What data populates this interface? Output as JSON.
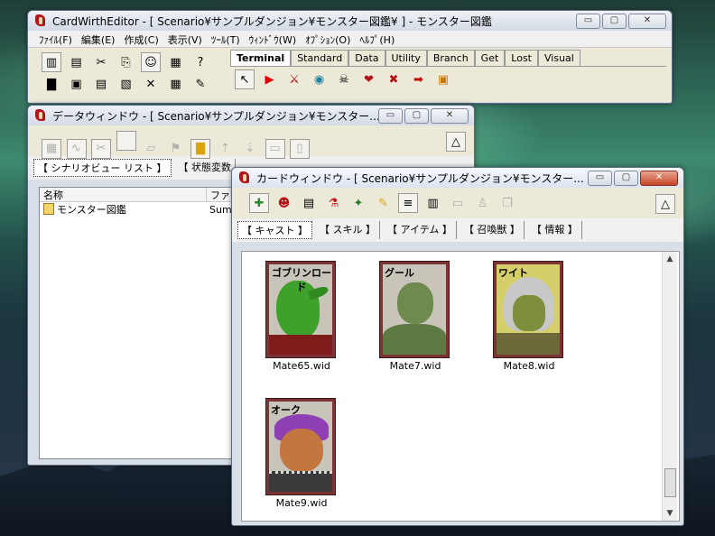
{
  "main_window": {
    "title": "CardWirthEditor - [ Scenario¥サンプルダンジョン¥モンスター図鑑¥ ] - モンスター図鑑",
    "menu": [
      "ﾌｧｲﾙ(F)",
      "編集(E)",
      "作成(C)",
      "表示(V)",
      "ﾂｰﾙ(T)",
      "ｳｨﾝﾄﾞｳ(W)",
      "ｵﾌﾟｼｮﾝ(O)",
      "ﾍﾙﾌﾟ(H)"
    ],
    "palette_tabs": [
      "Terminal",
      "Standard",
      "Data",
      "Utility",
      "Branch",
      "Get",
      "Lost",
      "Visual"
    ]
  },
  "data_window": {
    "title": "データウィンドウ - [ Scenario¥サンプルダンジョン¥モンスター...",
    "tabs": [
      "【 シナリオビュー リスト 】",
      "【 状態変数"
    ],
    "columns": [
      "名称",
      "ファイ"
    ],
    "rows": [
      {
        "name": "モンスター図鑑",
        "file": "Summ"
      }
    ]
  },
  "card_window": {
    "title": "カードウィンドウ - [ Scenario¥サンプルダンジョン¥モンスター...",
    "tabs": [
      "【 キャスト 】",
      "【 スキル 】",
      "【 アイテム 】",
      "【 召喚獣 】",
      "【 情報 】"
    ],
    "cards": [
      {
        "name": "ゴブリンロード",
        "file": "Mate65.wid",
        "accent": "#3ea12c"
      },
      {
        "name": "グール",
        "file": "Mate7.wid",
        "accent": "#5e7a43"
      },
      {
        "name": "ワイト",
        "file": "Mate8.wid",
        "accent": "#7d8f3b"
      },
      {
        "name": "オーク",
        "file": "Mate9.wid",
        "accent": "#c2773f"
      }
    ]
  },
  "controls": {
    "minimize": "▭",
    "maximize": "▢",
    "close": "✕"
  }
}
